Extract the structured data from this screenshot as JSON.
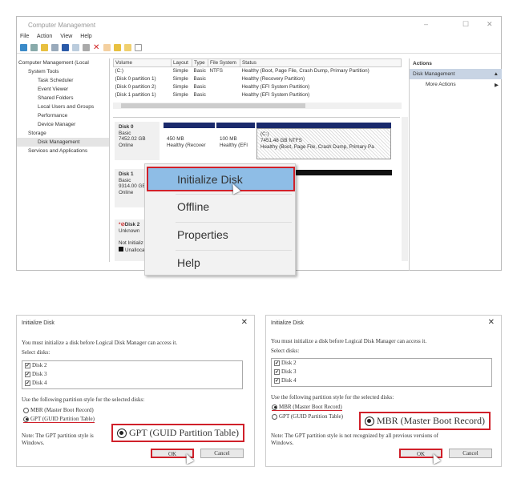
{
  "window": {
    "title": "Computer Management",
    "minimize": "–",
    "maximize": "☐",
    "close": "✕",
    "menu": [
      "File",
      "Action",
      "View",
      "Help"
    ],
    "tree": [
      "Computer Management (Local",
      "System Tools",
      "Task Scheduler",
      "Event Viewer",
      "Shared Folders",
      "Local Users and Groups",
      "Performance",
      "Device Manager",
      "Storage",
      "Disk Management",
      "Services and Applications"
    ],
    "volume_columns": [
      "Volume",
      "Layout",
      "Type",
      "File System",
      "Status"
    ],
    "volumes": [
      [
        "(C:)",
        "Simple",
        "Basic",
        "NTFS",
        "Healthy (Boot, Page File, Crash Dump, Primary Partition)"
      ],
      [
        "(Disk 0 partition 1)",
        "Simple",
        "Basic",
        "",
        "Healthy (Recovery Partition)"
      ],
      [
        "(Disk 0 partition 2)",
        "Simple",
        "Basic",
        "",
        "Healthy (EFI System Partition)"
      ],
      [
        "(Disk 1 partition 1)",
        "Simple",
        "Basic",
        "",
        "Healthy (EFI System Partition)"
      ]
    ],
    "disks": [
      {
        "name": "Disk 0",
        "type": "Basic",
        "size": "7452.02 GB",
        "state": "Online",
        "partitions": [
          {
            "l1": "450 MB",
            "l2": "Healthy (Recover"
          },
          {
            "l1": "100 MB",
            "l2": "Healthy (EFI"
          },
          {
            "l0": "(C:)",
            "l1": "7451.48 GB NTFS",
            "l2": "Healthy (Boot, Page File, Crash Dump, Primary Pa"
          }
        ]
      },
      {
        "name": "Disk 1",
        "type": "Basic",
        "size": "9314.00 GB",
        "state": "Online"
      },
      {
        "name": "Disk 2",
        "type": "Unknown",
        "state": "Not Initializ",
        "legend": "Unalloca"
      }
    ],
    "actions": {
      "header": "Actions",
      "section": "Disk Management",
      "more": "More Actions"
    }
  },
  "context_menu": [
    "Initialize Disk",
    "Offline",
    "Properties",
    "Help"
  ],
  "dialogs": [
    {
      "title": "Initialize Disk",
      "message": "You must initialize a disk before Logical Disk Manager can access it.",
      "select_label": "Select disks:",
      "disks": [
        "Disk 2",
        "Disk 3",
        "Disk 4"
      ],
      "style_label": "Use the following partition style for the selected disks:",
      "mbr": "MBR (Master Boot Record)",
      "gpt": "GPT (GUID Partition Table)",
      "selected": "gpt",
      "note": "Note: The GPT partition style is",
      "note2": "Windows.",
      "ok": "OK",
      "cancel": "Cancel",
      "callout": "GPT (GUID Partition Table)"
    },
    {
      "title": "Initialize Disk",
      "message": "You must initialize a disk before Logical Disk Manager can access it.",
      "select_label": "Select disks:",
      "disks": [
        "Disk 2",
        "Disk 3",
        "Disk 4"
      ],
      "style_label": "Use the following partition style for the selected disks:",
      "mbr": "MBR (Master Boot Record)",
      "gpt": "GPT (GUID Partition Table)",
      "selected": "mbr",
      "note": "Note: The GPT partition style is not recognized by all previous versions of",
      "note2": "Windows.",
      "ok": "OK",
      "cancel": "Cancel",
      "callout": "MBR (Master Boot Record)"
    }
  ]
}
